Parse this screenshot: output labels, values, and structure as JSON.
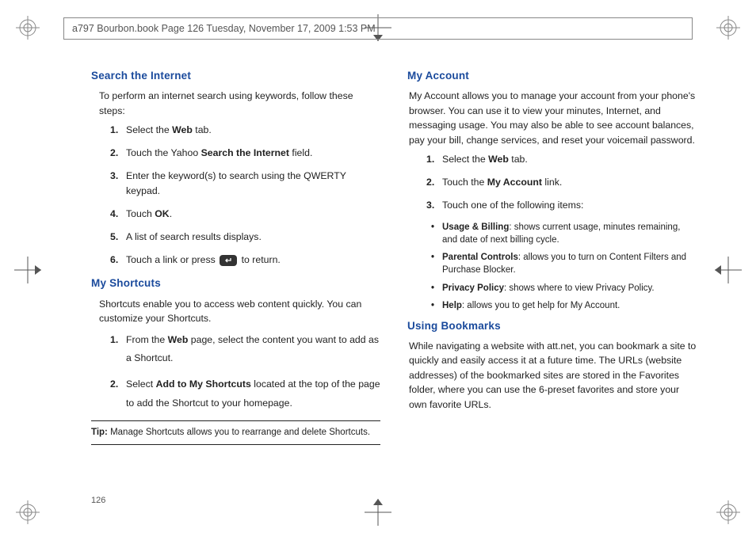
{
  "header": "a797 Bourbon.book  Page 126  Tuesday, November 17, 2009  1:53 PM",
  "page_number": "126",
  "left": {
    "h1": "Search the Internet",
    "p1": "To perform an internet search using keywords, follow these steps:",
    "steps1": {
      "s1a": "Select the ",
      "s1b": "Web",
      "s1c": " tab.",
      "s2a": "Touch the Yahoo ",
      "s2b": "Search the Internet",
      "s2c": " field.",
      "s3": "Enter the keyword(s) to search using the QWERTY keypad.",
      "s4a": "Touch ",
      "s4b": "OK",
      "s4c": ".",
      "s5": "A list of search results displays.",
      "s6a": "Touch a link or press ",
      "s6b": " to return."
    },
    "h2": "My Shortcuts",
    "p2": "Shortcuts enable you to access web content quickly. You can customize your Shortcuts.",
    "steps2": {
      "s1a": "From the ",
      "s1b": "Web",
      "s1c": " page, select the content you want to add as a Shortcut.",
      "s2a": "Select ",
      "s2b": "Add to My Shortcuts",
      "s2c": " located at the top of the page to add the Shortcut to your homepage."
    },
    "tip_label": "Tip:",
    "tip_text": " Manage Shortcuts allows you to rearrange and delete Shortcuts."
  },
  "right": {
    "h1": "My Account",
    "p1": "My Account allows you to manage your account from your phone's browser. You can use it to view your minutes, Internet, and messaging usage. You may also be able to see account balances, pay your bill, change services, and reset your voicemail password.",
    "steps1": {
      "s1a": "Select the ",
      "s1b": "Web",
      "s1c": " tab.",
      "s2a": "Touch the ",
      "s2b": "My Account",
      "s2c": " link.",
      "s3": "Touch one of the following items:"
    },
    "bullets": {
      "b1a": "Usage & Billing",
      "b1b": ": shows current usage, minutes remaining, and date of next billing cycle.",
      "b2a": "Parental Controls",
      "b2b": ": allows you to turn on Content Filters and Purchase Blocker.",
      "b3a": "Privacy Policy",
      "b3b": ": shows where to view Privacy Policy.",
      "b4a": "Help",
      "b4b": ": allows you to get help for My Account."
    },
    "h2": "Using Bookmarks",
    "p2": "While navigating a website with att.net, you can bookmark a site to quickly and easily access it at a future time. The URLs (website addresses) of the bookmarked sites are stored in the Favorites folder, where you can use the 6-preset favorites and store your own favorite URLs."
  }
}
